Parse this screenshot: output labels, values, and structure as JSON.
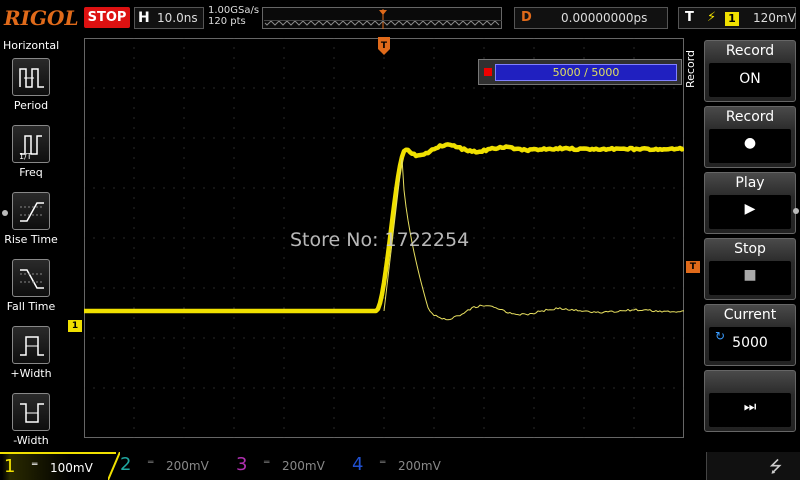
{
  "header": {
    "brand": "RIGOL",
    "run_status": "STOP",
    "horizontal_label": "H",
    "timebase": "10.0ns",
    "sample_rate": "1.00GSa/s",
    "memory_depth": "120 pts",
    "delay_label": "D",
    "delay_value": "0.00000000ps",
    "trigger_label": "T",
    "trigger_slope": "rising-edge",
    "trigger_source": "1",
    "trigger_level": "120mV",
    "colors": {
      "brand": "#e06a1a",
      "stop": "#dd1111"
    }
  },
  "left_menu": {
    "title": "Horizontal",
    "items": [
      {
        "id": "period",
        "label": "Period",
        "icon": "period-icon"
      },
      {
        "id": "freq",
        "label": "Freq",
        "icon": "freq-icon"
      },
      {
        "id": "rise",
        "label": "Rise Time",
        "icon": "rise-time-icon"
      },
      {
        "id": "fall",
        "label": "Fall Time",
        "icon": "fall-time-icon"
      },
      {
        "id": "pwidth",
        "label": "+Width",
        "icon": "positive-width-icon"
      },
      {
        "id": "nwidth",
        "label": "-Width",
        "icon": "negative-width-icon"
      }
    ]
  },
  "display": {
    "trigger_marker": "T",
    "ch1_marker": "1",
    "trigger_level_marker": "T",
    "watermark": "Store No: 1722254",
    "record_progress": {
      "text": "5000 / 5000",
      "fraction": 1.0
    },
    "colors": {
      "ch1": "#f0e000",
      "grid": "#3a3a3a",
      "trigger": "#e06a1a"
    }
  },
  "right_menu": {
    "title": "Record",
    "items": [
      {
        "id": "record_mode",
        "title": "Record",
        "value": "ON"
      },
      {
        "id": "record_start",
        "title": "Record",
        "value": "●"
      },
      {
        "id": "play",
        "title": "Play",
        "value": "▶"
      },
      {
        "id": "stop",
        "title": "Stop",
        "value": "■"
      },
      {
        "id": "current",
        "title": "Current",
        "value": "5000"
      },
      {
        "id": "next",
        "title": "",
        "value": "⏭"
      }
    ]
  },
  "footer": {
    "channels": [
      {
        "num": "1",
        "coupling": "═",
        "scale": "100mV",
        "color": "#f0e000"
      },
      {
        "num": "2",
        "coupling": "═",
        "scale": "200mV",
        "color": "#1fa7a0"
      },
      {
        "num": "3",
        "coupling": "═",
        "scale": "200mV",
        "color": "#b030b0"
      },
      {
        "num": "4",
        "coupling": "═",
        "scale": "200mV",
        "color": "#2050d0"
      }
    ],
    "usb_icon": "usb-icon"
  }
}
